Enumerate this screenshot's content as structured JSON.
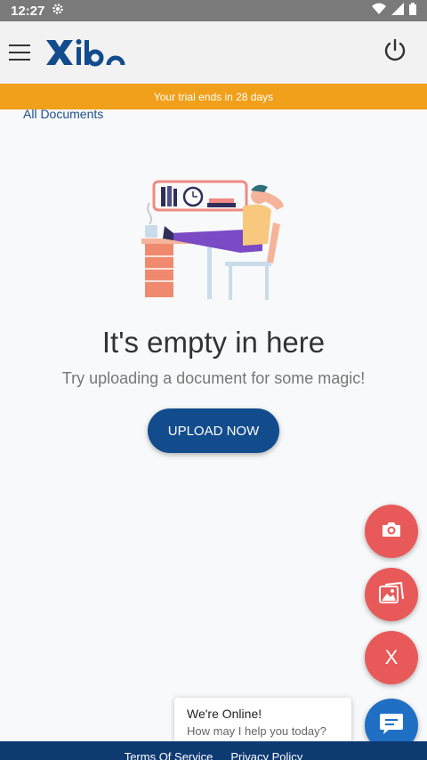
{
  "status_bar": {
    "time": "12:27"
  },
  "app_bar": {
    "logo_text": "Xibo"
  },
  "trial_banner": {
    "text": "Your trial ends in 28 days"
  },
  "breadcrumb": {
    "label": "All Documents"
  },
  "empty_state": {
    "title": "It's empty in here",
    "subtitle": "Try uploading a document for some magic!",
    "upload_label": "UPLOAD NOW"
  },
  "fabs": {
    "close_label": "X"
  },
  "chat": {
    "title": "We're Online!",
    "subtitle": "How may I help you today?"
  },
  "footer": {
    "terms_label": "Terms Of Service",
    "privacy_label": "Privacy Policy"
  },
  "colors": {
    "accent": "#124c8d",
    "banner": "#f0a01a",
    "fab": "#e85a5a",
    "chat": "#1f6fc5",
    "footer": "#0e3a72"
  },
  "icons": [
    "gear-icon",
    "wifi-icon",
    "signal-icon",
    "battery-icon",
    "menu-icon",
    "power-icon",
    "camera-icon",
    "gallery-icon",
    "chat-icon"
  ]
}
